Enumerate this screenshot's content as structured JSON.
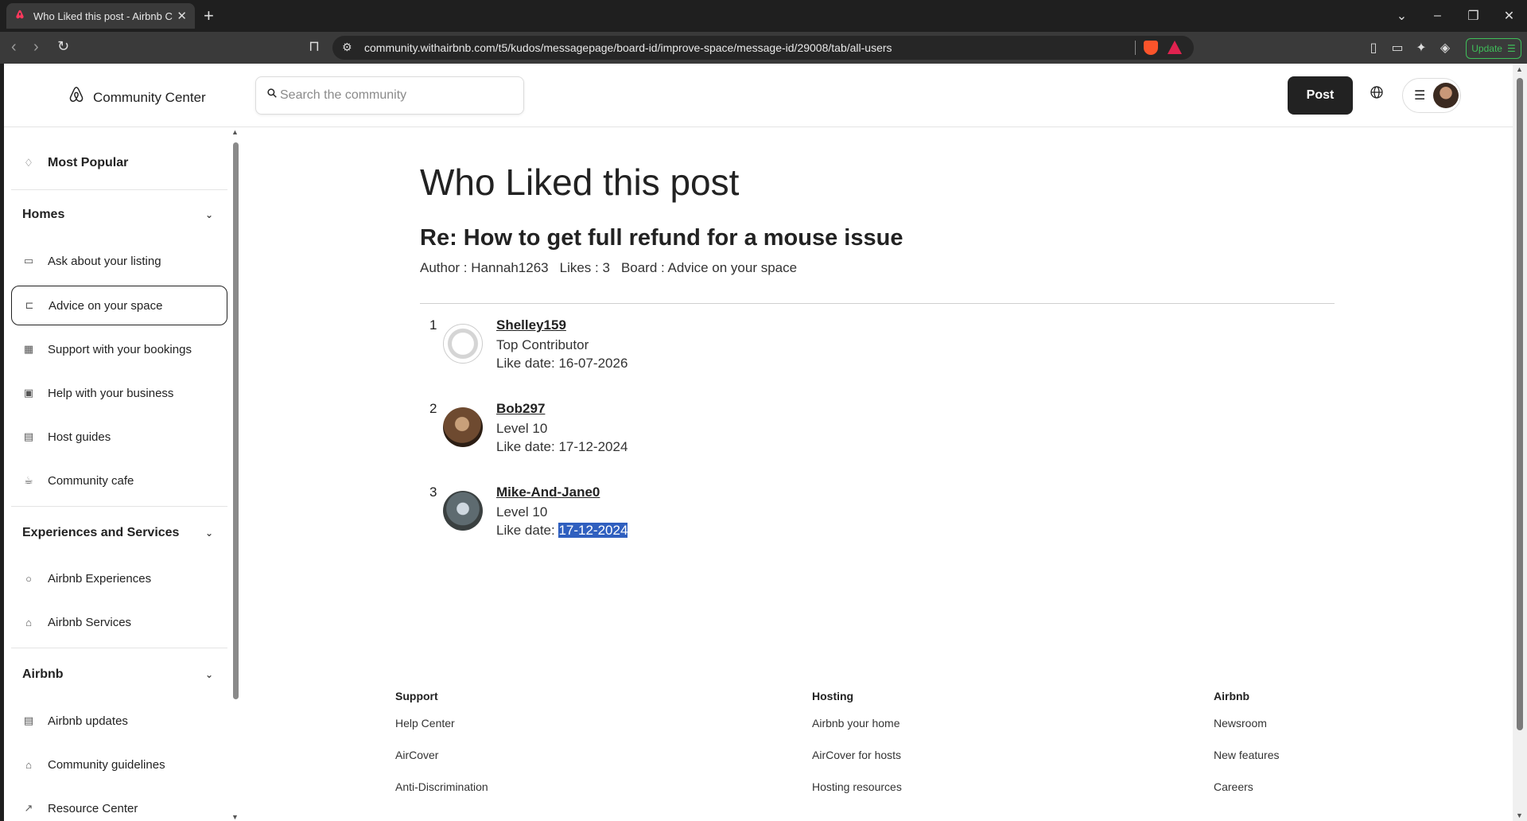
{
  "browser": {
    "tab_title": "Who Liked this post - Airbnb Co",
    "url": "community.withairbnb.com/t5/kudos/messagepage/board-id/improve-space/message-id/29008/tab/all-users",
    "update_label": "Update"
  },
  "header": {
    "logo_text": "Community Center",
    "search_placeholder": "Search the community",
    "post_label": "Post"
  },
  "sidebar": {
    "most_popular": "Most Popular",
    "sections": [
      {
        "title": "Homes",
        "items": [
          "Ask about your listing",
          "Advice on your space",
          "Support with your bookings",
          "Help with your business",
          "Host guides",
          "Community cafe"
        ]
      },
      {
        "title": "Experiences and Services",
        "items": [
          "Airbnb Experiences",
          "Airbnb Services"
        ]
      },
      {
        "title": "Airbnb",
        "items": [
          "Airbnb updates",
          "Community guidelines",
          "Resource Center"
        ]
      }
    ],
    "selected": "Advice on your space"
  },
  "main": {
    "page_title": "Who Liked this post",
    "post_title": "Re: How to get full refund for a mouse issue",
    "author": "Author : Hannah1263",
    "likes": "Likes : 3",
    "board": "Board : Advice on your space",
    "likers": [
      {
        "num": "1",
        "name": "Shelley159",
        "rank": "Top Contributor",
        "date_label": "Like date: ",
        "date": "16-07-2026"
      },
      {
        "num": "2",
        "name": "Bob297",
        "rank": "Level 10",
        "date_label": "Like date: ",
        "date": "17-12-2024"
      },
      {
        "num": "3",
        "name": "Mike-And-Jane0",
        "rank": "Level 10",
        "date_label": "Like date: ",
        "date": "17-12-2024",
        "date_selected": true
      }
    ]
  },
  "footer": {
    "columns": [
      {
        "heading": "Support",
        "links": [
          "Help Center",
          "AirCover",
          "Anti-Discrimination"
        ]
      },
      {
        "heading": "Hosting",
        "links": [
          "Airbnb your home",
          "AirCover for hosts",
          "Hosting resources"
        ]
      },
      {
        "heading": "Airbnb",
        "links": [
          "Newsroom",
          "New features",
          "Careers"
        ]
      }
    ]
  }
}
